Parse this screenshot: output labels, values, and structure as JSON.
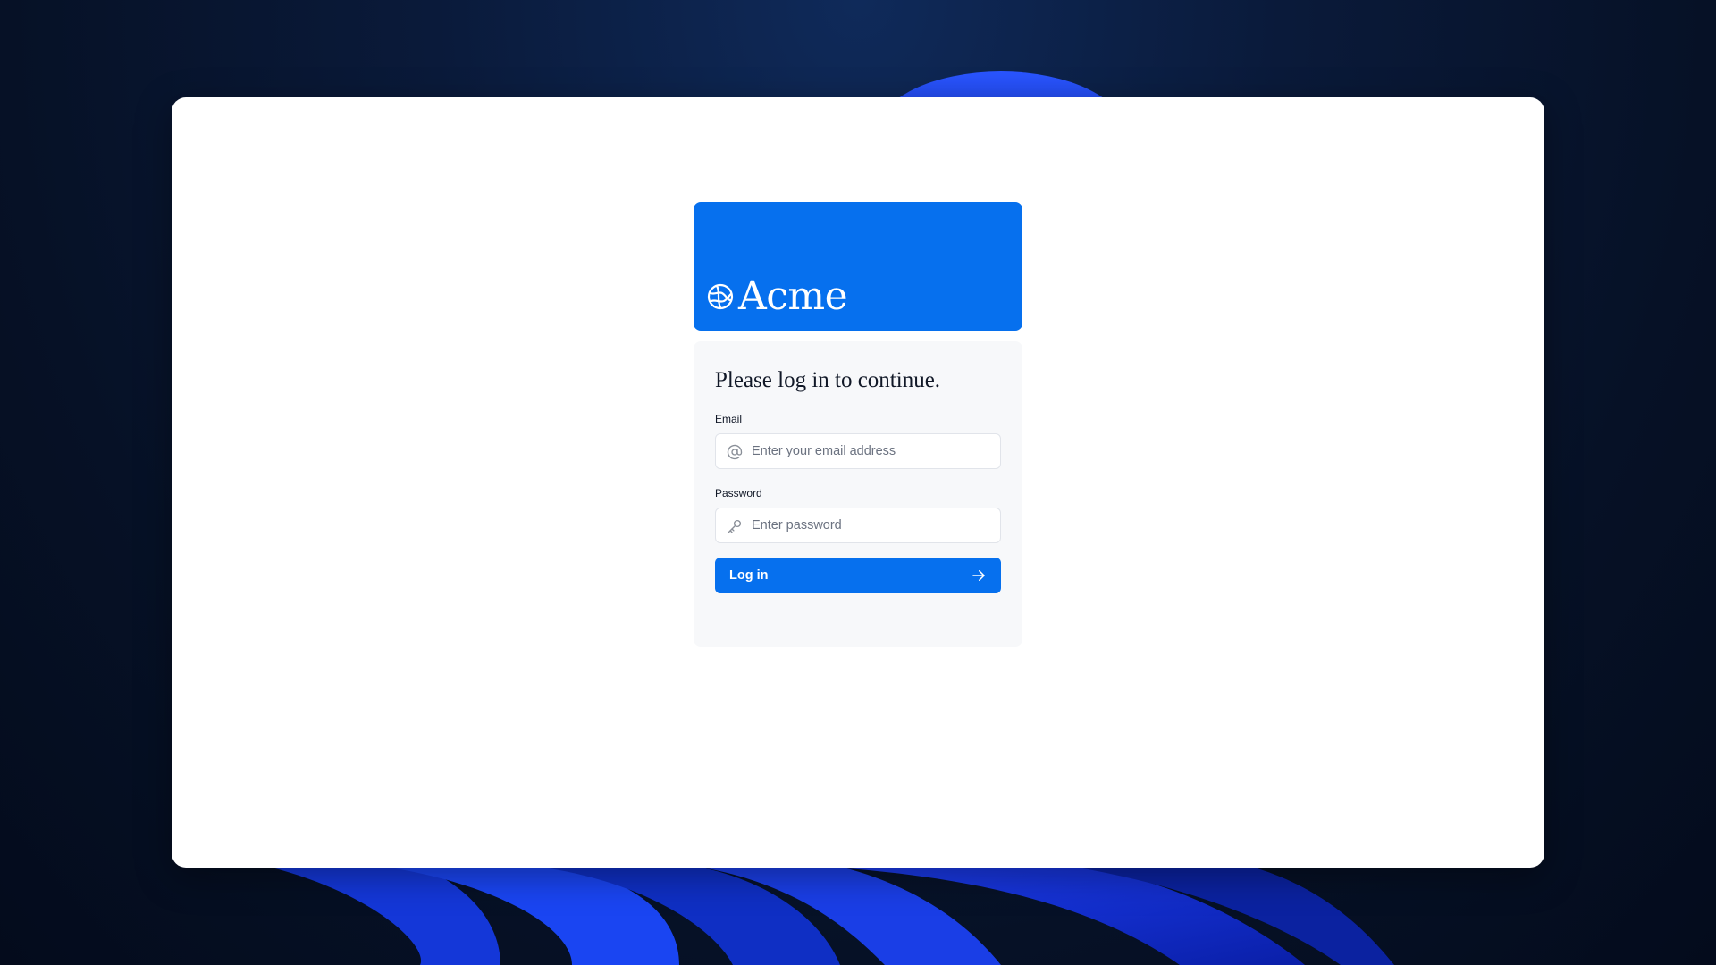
{
  "brand": {
    "name": "Acme",
    "color": "#0670ee",
    "logo_icon": "globe-icon"
  },
  "form": {
    "title": "Please log in to continue.",
    "email": {
      "label": "Email",
      "value": "",
      "placeholder": "Enter your email address",
      "icon": "at-sign-icon"
    },
    "password": {
      "label": "Password",
      "value": "",
      "placeholder": "Enter password",
      "icon": "key-icon"
    },
    "submit": {
      "label": "Log in",
      "icon": "arrow-right-icon"
    }
  }
}
